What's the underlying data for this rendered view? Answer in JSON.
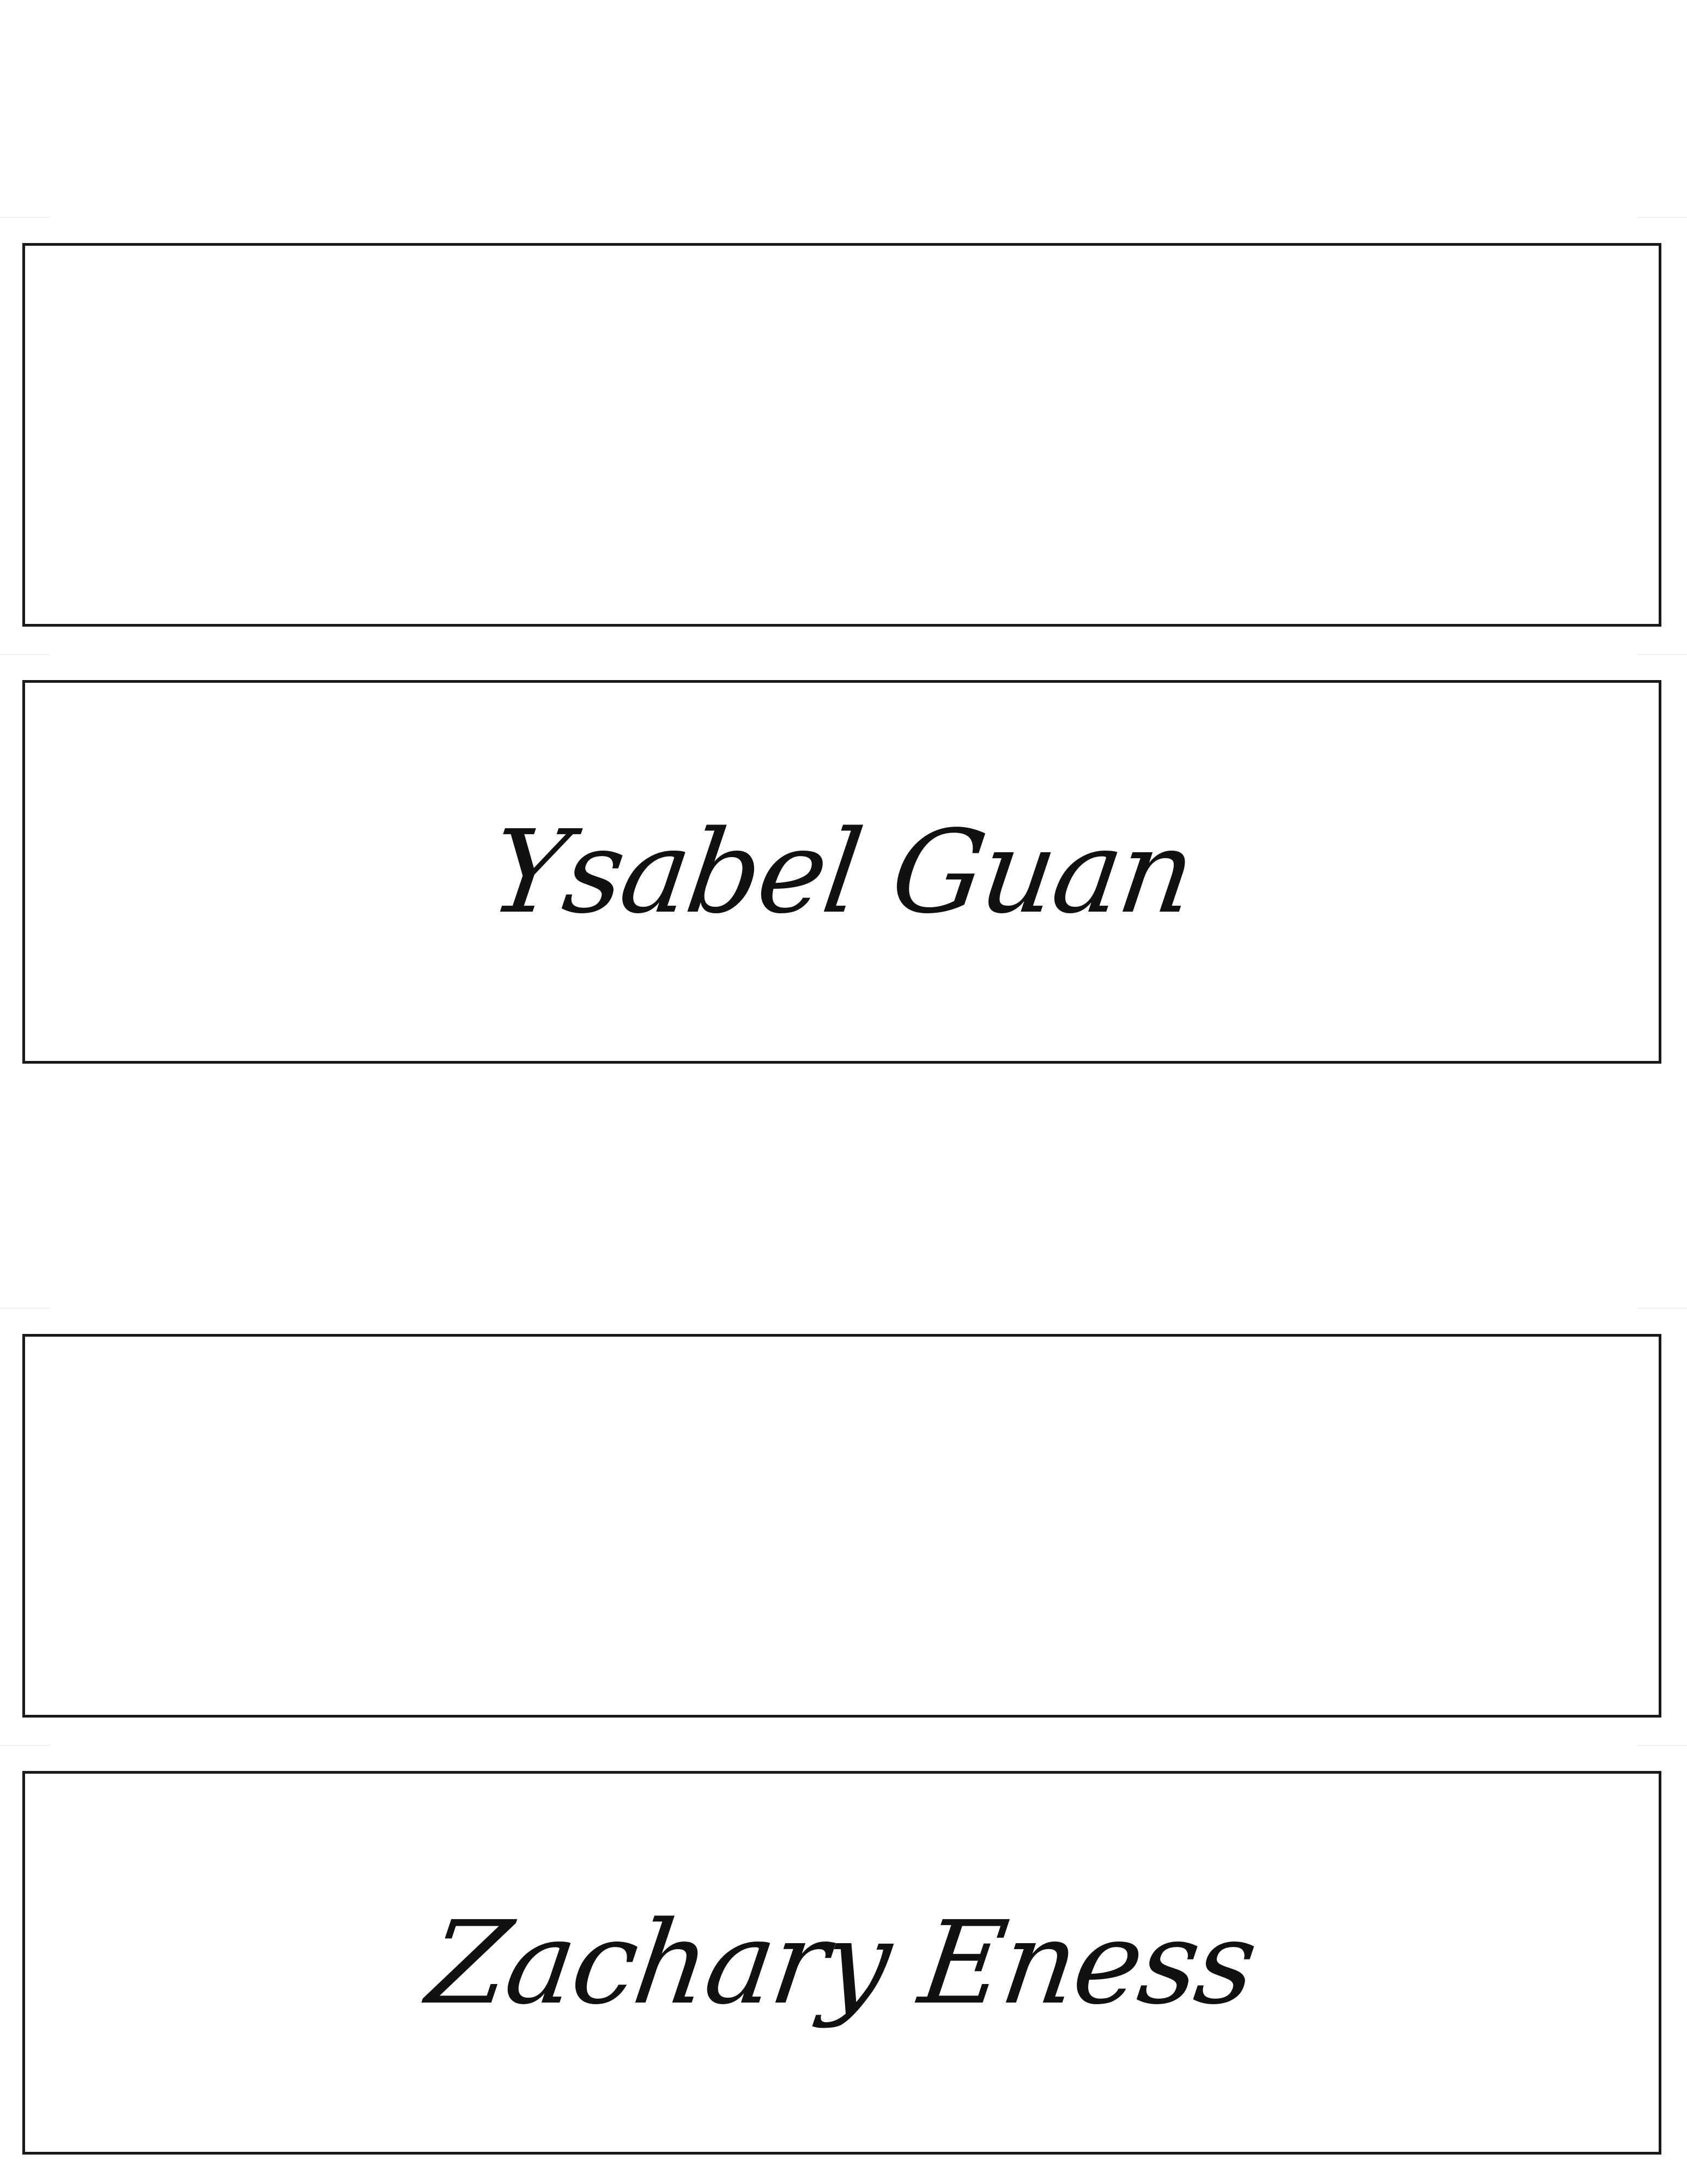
{
  "place_cards": [
    {
      "front_name": "",
      "back_name": "Ysabel Guan"
    },
    {
      "front_name": "",
      "back_name": "Zachary Eness"
    }
  ],
  "colors": {
    "page_background": "#ffffff",
    "card_border": "#1a1a1a",
    "ink": "#111111",
    "fold_mark": "#f1f1f1"
  }
}
